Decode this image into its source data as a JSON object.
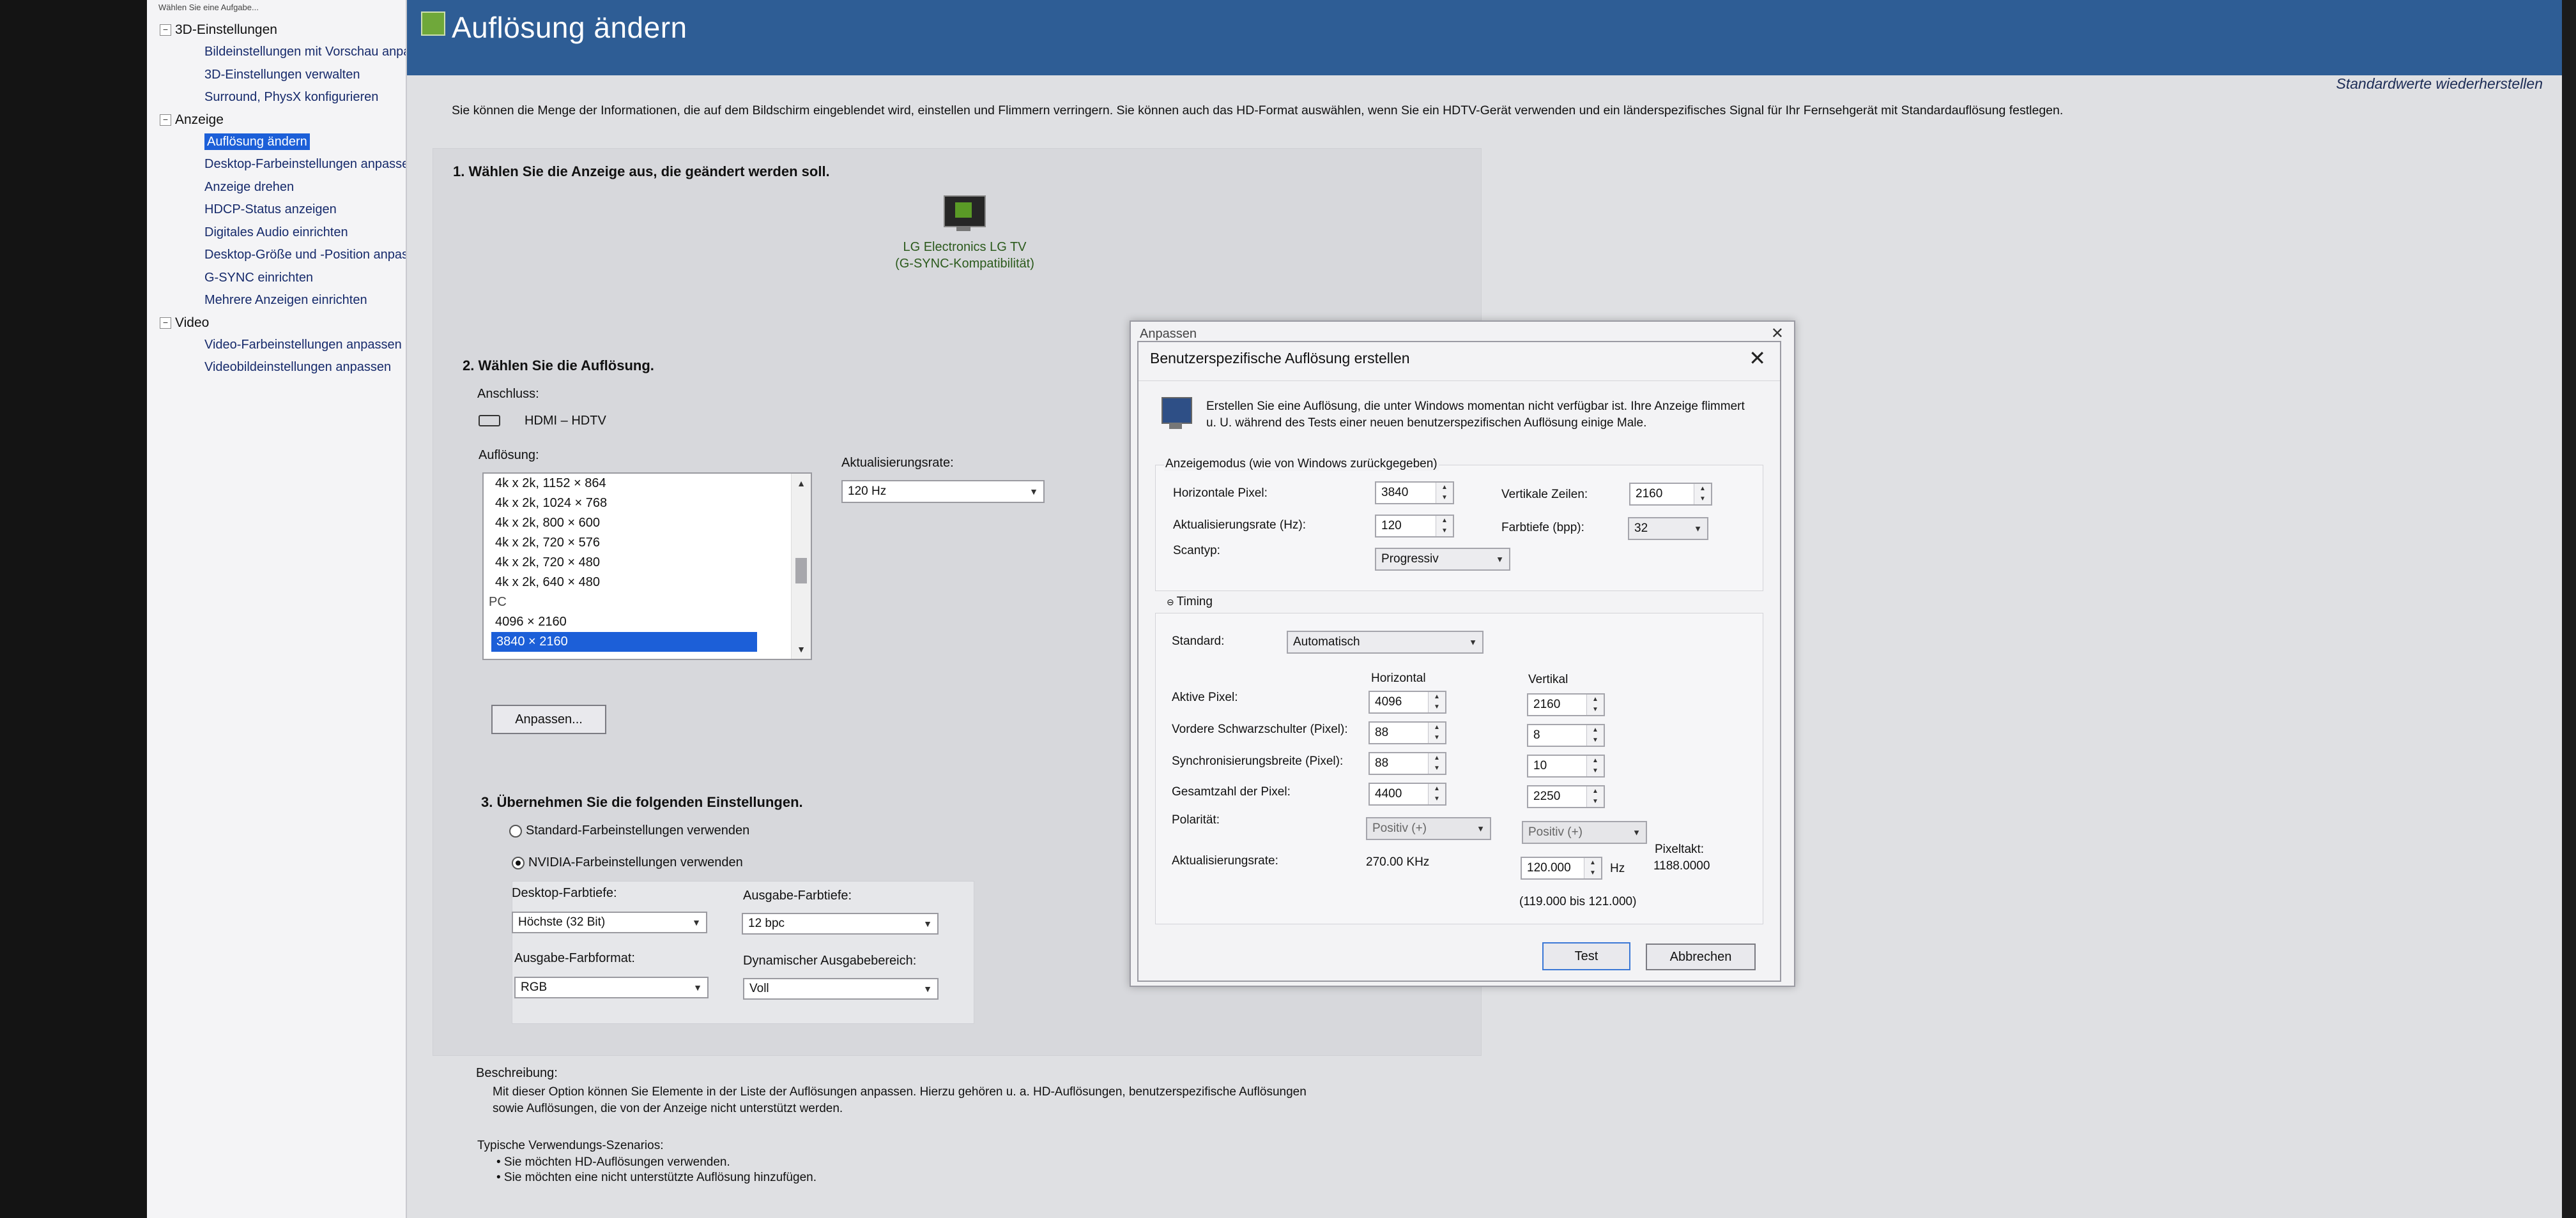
{
  "sidebar": {
    "top_text": "Wählen Sie eine Aufgabe...",
    "groups": [
      {
        "label": "3D-Einstellungen",
        "toggle": "−",
        "items": [
          "Bildeinstellungen mit Vorschau anpa",
          "3D-Einstellungen verwalten",
          "Surround, PhysX konfigurieren"
        ]
      },
      {
        "label": "Anzeige",
        "toggle": "−",
        "items": [
          "Auflösung ändern",
          "Desktop-Farbeinstellungen anpassen",
          "Anzeige drehen",
          "HDCP-Status anzeigen",
          "Digitales Audio einrichten",
          "Desktop-Größe und -Position anpass",
          "G-SYNC einrichten",
          "Mehrere Anzeigen einrichten"
        ]
      },
      {
        "label": "Video",
        "toggle": "−",
        "items": [
          "Video-Farbeinstellungen anpassen",
          "Videobildeinstellungen anpassen"
        ]
      }
    ]
  },
  "header": {
    "title": "Auflösung ändern",
    "restore": "Standardwerte wiederherstellen",
    "intro": "Sie können die Menge der Informationen, die auf dem Bildschirm eingeblendet wird, einstellen und Flimmern verringern. Sie können auch das HD-Format auswählen, wenn Sie ein HDTV-Gerät verwenden und ein länderspezifisches Signal für Ihr Fernsehgerät mit Standardauflösung festlegen."
  },
  "step1": {
    "title": "1. Wählen Sie die Anzeige aus, die geändert werden soll.",
    "monitor_name": "LG Electronics LG TV",
    "monitor_sub": "(G-SYNC-Kompatibilität)"
  },
  "step2": {
    "title": "2. Wählen Sie die Auflösung.",
    "connection_label": "Anschluss:",
    "connection_value": "HDMI – HDTV",
    "resolution_label": "Auflösung:",
    "refresh_label": "Aktualisierungsrate:",
    "refresh_value": "120 Hz",
    "resolutions": [
      "4k x 2k, 1152 × 864",
      "4k x 2k, 1024 × 768",
      "4k x 2k, 800 × 600",
      "4k x 2k, 720 × 576",
      "4k x 2k, 720 × 480",
      "4k x 2k, 640 × 480"
    ],
    "category": "PC",
    "pc_resolutions": [
      "4096 × 2160",
      "3840 × 2160"
    ],
    "customize_button": "Anpassen..."
  },
  "step3": {
    "title": "3. Übernehmen Sie die folgenden Einstellungen.",
    "radio_default": "Standard-Farbeinstellungen verwenden",
    "radio_nvidia": "NVIDIA-Farbeinstellungen verwenden",
    "desktop_depth_label": "Desktop-Farbtiefe:",
    "desktop_depth_value": "Höchste (32 Bit)",
    "output_depth_label": "Ausgabe-Farbtiefe:",
    "output_depth_value": "12 bpc",
    "output_format_label": "Ausgabe-Farbformat:",
    "output_format_value": "RGB",
    "dynamic_range_label": "Dynamischer Ausgabebereich:",
    "dynamic_range_value": "Voll"
  },
  "description": {
    "label": "Beschreibung:",
    "text1": "Mit dieser Option können Sie Elemente in der Liste der Auflösungen anpassen. Hierzu gehören u. a. HD-Auflösungen, benutzerspezifische Auflösungen",
    "text2": "sowie Auflösungen, die von der Anzeige nicht unterstützt werden.",
    "scenarios_label": "Typische Verwendungs-Szenarios:",
    "scenarios": [
      "• Sie möchten HD-Auflösungen verwenden.",
      "• Sie möchten eine nicht unterstützte Auflösung hinzufügen."
    ]
  },
  "dialog_back": {
    "title": "Anpassen"
  },
  "dialog": {
    "title": "Benutzerspezifische Auflösung erstellen",
    "message": "Erstellen Sie eine Auflösung, die unter Windows momentan nicht verfügbar ist. Ihre Anzeige flimmert u. U. während des Tests einer neuen benutzerspezifischen Auflösung einige Male.",
    "mode_group": "Anzeigemodus (wie von Windows zurückgegeben)",
    "h_pixels_label": "Horizontale Pixel:",
    "h_pixels": "3840",
    "v_lines_label": "Vertikale Zeilen:",
    "v_lines": "2160",
    "refresh_label": "Aktualisierungsrate (Hz):",
    "refresh": "120",
    "depth_label": "Farbtiefe (bpp):",
    "depth": "32",
    "scan_label": "Scantyp:",
    "scan": "Progressiv",
    "timing_label": "Timing",
    "standard_label": "Standard:",
    "standard": "Automatisch",
    "col_h": "Horizontal",
    "col_v": "Vertikal",
    "active_label": "Aktive Pixel:",
    "active_h": "4096",
    "active_v": "2160",
    "porch_label": "Vordere Schwarzschulter (Pixel):",
    "porch_h": "88",
    "porch_v": "8",
    "sync_label": "Synchronisierungsbreite (Pixel):",
    "sync_h": "88",
    "sync_v": "10",
    "total_label": "Gesamtzahl der Pixel:",
    "total_h": "4400",
    "total_v": "2250",
    "polarity_label": "Polarität:",
    "polarity_h": "Positiv (+)",
    "polarity_v": "Positiv (+)",
    "rate_label": "Aktualisierungsrate:",
    "rate_khz": "270.00 KHz",
    "rate_hz": "120.000",
    "hz_unit": "Hz",
    "rate_range": "(119.000 bis 121.000)",
    "pixclk_label": "Pixeltakt:",
    "pixclk": "1188.0000",
    "test_button": "Test",
    "cancel_button": "Abbrechen"
  }
}
